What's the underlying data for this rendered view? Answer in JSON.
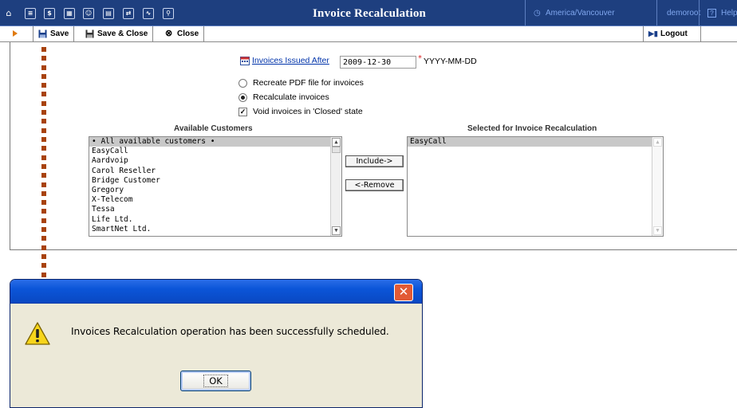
{
  "header": {
    "title": "Invoice Recalculation",
    "timezone": "America/Vancouver",
    "user": "demoroot",
    "help": "Help",
    "nav_icons": [
      "home-icon",
      "list-icon",
      "dollar-icon",
      "grid-icon",
      "user-icon",
      "calendar-icon",
      "transfer-icon",
      "chart-icon",
      "search-icon"
    ]
  },
  "toolbar": {
    "save": "Save",
    "save_close": "Save & Close",
    "close": "Close",
    "logout": "Logout"
  },
  "form": {
    "issued_after_label": "Invoices Issued After",
    "issued_after_value": "2009-12-30",
    "date_format": "YYYY-MM-DD",
    "required_mark": "*",
    "options": [
      {
        "label": "Recreate PDF file for invoices",
        "type": "radio",
        "checked": false
      },
      {
        "label": "Recalculate invoices",
        "type": "radio",
        "checked": true
      },
      {
        "label": "Void invoices in 'Closed' state",
        "type": "checkbox",
        "checked": true
      }
    ]
  },
  "available": {
    "heading": "Available Customers",
    "items": [
      "• All available customers •",
      "EasyCall",
      "Aardvoip",
      "Carol Reseller",
      "Bridge Customer",
      "Gregory",
      "X-Telecom",
      "Tessa",
      "Life Ltd.",
      "SmartNet Ltd."
    ]
  },
  "selected": {
    "heading": "Selected for Invoice Recalculation",
    "items": [
      "EasyCall"
    ]
  },
  "buttons": {
    "include": "Include->",
    "remove": "<-Remove"
  },
  "dialog": {
    "message": "Invoices Recalculation operation has been successfully scheduled.",
    "ok": "OK",
    "close_glyph": "✕"
  },
  "colors": {
    "header_bg": "#1e3f7f",
    "accent_link": "#7fa6ee",
    "dotted_line": "#a8420c",
    "dialog_title": "#0b55d8"
  }
}
